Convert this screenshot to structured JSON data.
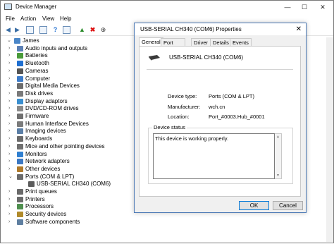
{
  "window": {
    "title": "Device Manager",
    "controls": {
      "minimize": "—",
      "maximize": "☐",
      "close": "✕"
    }
  },
  "menu": [
    "File",
    "Action",
    "View",
    "Help"
  ],
  "toolbar_icons": [
    "back-arrow-icon",
    "forward-arrow-icon",
    "properties-icon",
    "properties-sheet-icon",
    "help-icon",
    "monitor-icon",
    "update-driver-icon",
    "uninstall-icon",
    "download-icon"
  ],
  "tree": {
    "root": "James",
    "items": [
      {
        "label": "Audio inputs and outputs",
        "color": "#5a7fb5"
      },
      {
        "label": "Batteries",
        "color": "#4a9b3a"
      },
      {
        "label": "Bluetooth",
        "color": "#1f6fd1"
      },
      {
        "label": "Cameras",
        "color": "#555555"
      },
      {
        "label": "Computer",
        "color": "#3d7cc9"
      },
      {
        "label": "Digital Media Devices",
        "color": "#6c6c6c"
      },
      {
        "label": "Disk drives",
        "color": "#7a7a7a"
      },
      {
        "label": "Display adaptors",
        "color": "#3a8fd0"
      },
      {
        "label": "DVD/CD-ROM drives",
        "color": "#8a8a8a"
      },
      {
        "label": "Firmware",
        "color": "#6f6f6f"
      },
      {
        "label": "Human Interface Devices",
        "color": "#7b7b7b"
      },
      {
        "label": "Imaging devices",
        "color": "#5b7fa7"
      },
      {
        "label": "Keyboards",
        "color": "#6b6b6b"
      },
      {
        "label": "Mice and other pointing devices",
        "color": "#707070"
      },
      {
        "label": "Monitors",
        "color": "#2f7fd0"
      },
      {
        "label": "Network adapters",
        "color": "#3b78c3"
      },
      {
        "label": "Other devices",
        "color": "#b07a2a"
      },
      {
        "label": "Ports (COM & LPT)",
        "color": "#6b6b6b",
        "expanded": true
      },
      {
        "label": "USB-SERIAL CH340 (COM6)",
        "color": "#5c5c5c",
        "child": true
      },
      {
        "label": "Print queues",
        "color": "#6a6a6a"
      },
      {
        "label": "Printers",
        "color": "#6a6a6a"
      },
      {
        "label": "Processors",
        "color": "#4e8f4e"
      },
      {
        "label": "Security devices",
        "color": "#b08a2a"
      },
      {
        "label": "Software components",
        "color": "#5f7fa0"
      }
    ]
  },
  "dialog": {
    "title": "USB-SERIAL CH340 (COM6) Properties",
    "close": "✕",
    "tabs": [
      "General",
      "Port Settings",
      "Driver",
      "Details",
      "Events"
    ],
    "device_name": "USB-SERIAL CH340 (COM6)",
    "props": [
      {
        "label": "Device type:",
        "value": "Ports (COM & LPT)"
      },
      {
        "label": "Manufacturer:",
        "value": "wch.cn"
      },
      {
        "label": "Location:",
        "value": "Port_#0003.Hub_#0001"
      }
    ],
    "status_legend": "Device status",
    "status_text": "This device is working properly.",
    "ok": "OK",
    "cancel": "Cancel"
  }
}
